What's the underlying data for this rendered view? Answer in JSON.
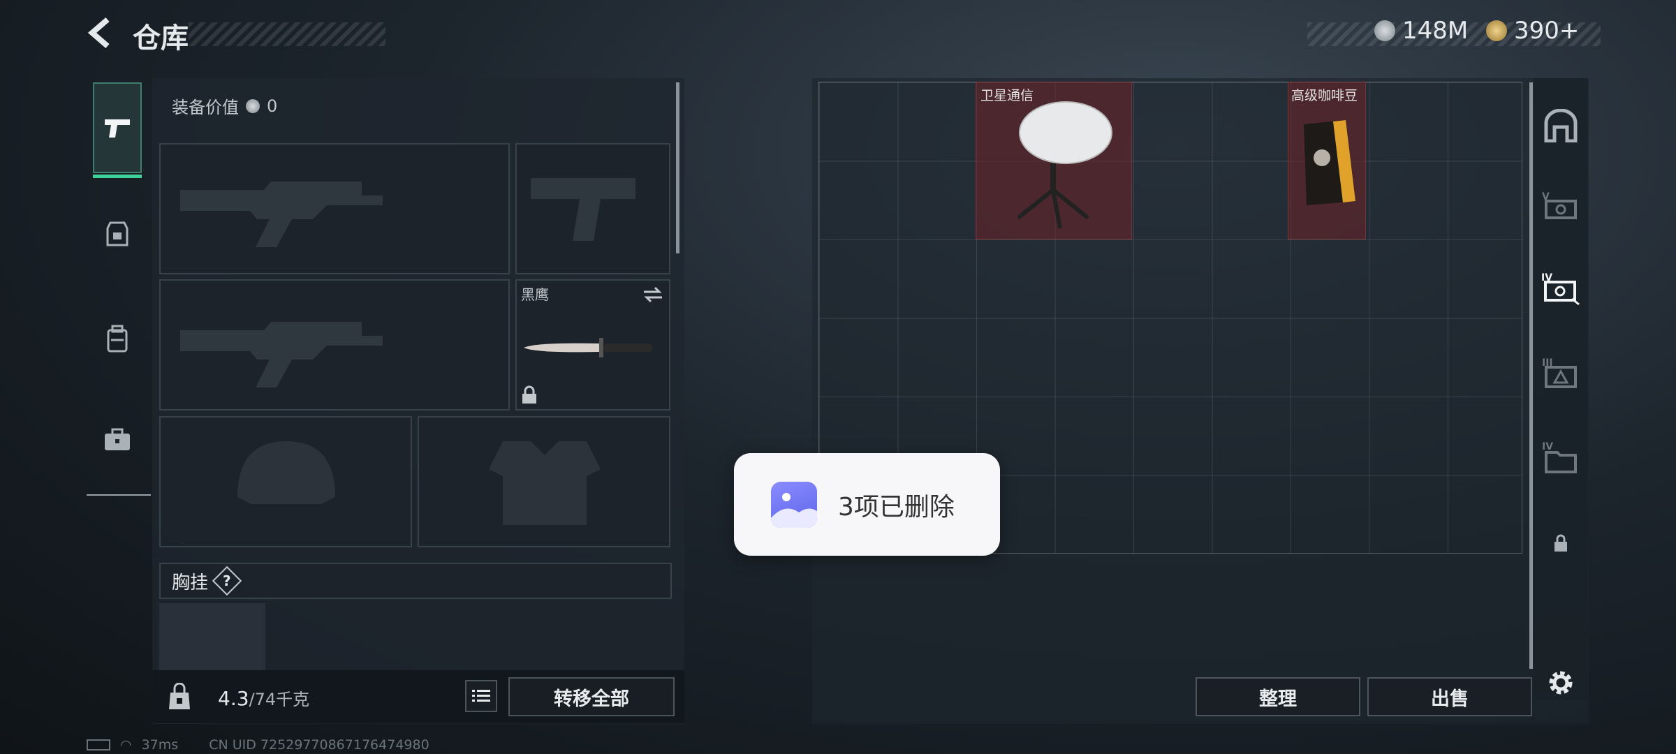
{
  "header": {
    "title": "仓库",
    "currency_silver": "148M",
    "currency_gold": "390+"
  },
  "left_tabs": [
    {
      "icon": "pistol-icon",
      "active": true
    },
    {
      "icon": "armor-icon",
      "active": false
    },
    {
      "icon": "backpack-icon",
      "active": false
    },
    {
      "icon": "toolbox-icon",
      "active": false
    }
  ],
  "equipment": {
    "value_label": "装备价值",
    "value_amount": "0",
    "knife_label": "黑鹰",
    "chest_rig_label": "胸挂",
    "chest_rig_help": "?"
  },
  "bottom_bar": {
    "weight_current": "4.3",
    "weight_max": "/74千克",
    "transfer_all_label": "转移全部"
  },
  "storage": {
    "items": [
      {
        "name": "卫星通信",
        "icon": "satellite-dish-icon"
      },
      {
        "name": "高级咖啡豆",
        "icon": "coffee-bag-icon"
      }
    ],
    "sort_label": "整理",
    "sell_label": "出售"
  },
  "toast": {
    "message": "3项已删除",
    "icon": "gallery-icon"
  },
  "status_bar": {
    "ping": "37ms",
    "uid": "CN UID 7252977086717647498​0"
  },
  "colors": {
    "accent_green": "#3fd19a",
    "item_red": "#6e2328"
  }
}
